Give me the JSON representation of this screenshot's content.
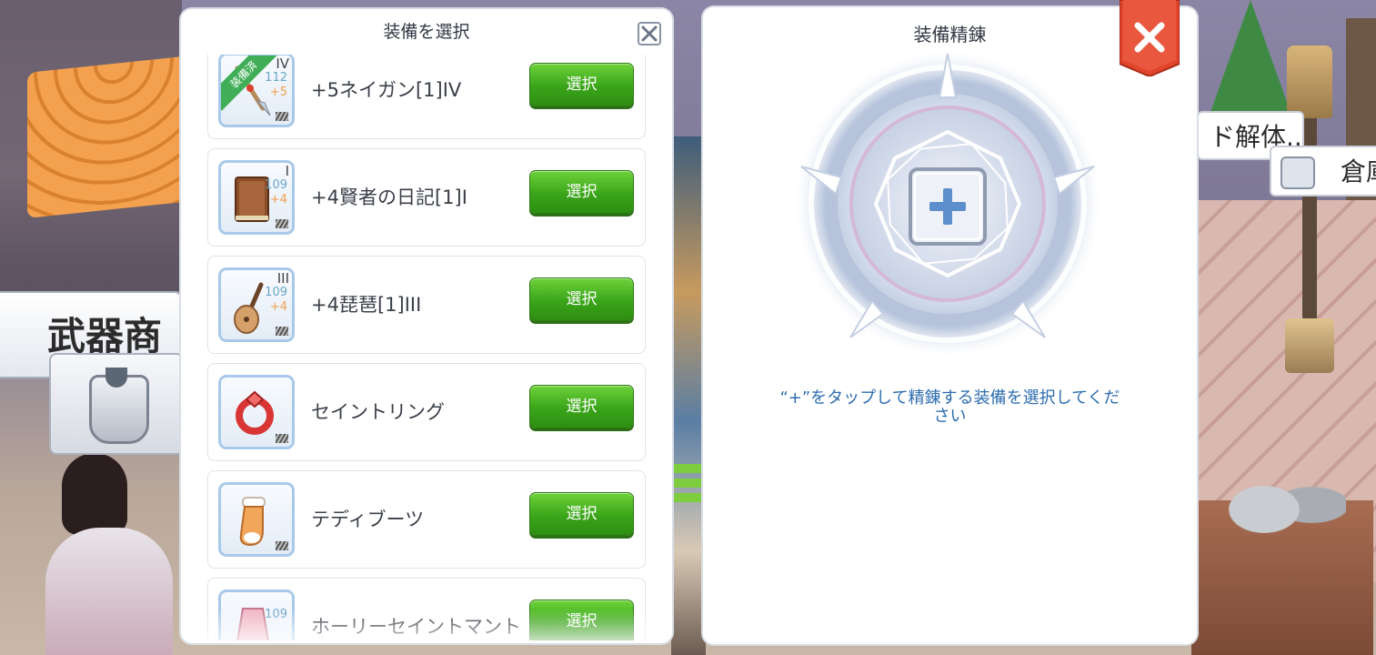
{
  "world": {
    "shop_sign": "武器商",
    "npc_label_1": "ド解体...",
    "npc_label_2": "倉庫"
  },
  "equip_select_panel": {
    "title": "装備を選択",
    "close_icon": "close-x-icon",
    "items": [
      {
        "name": "+5ネイガン[1]IV",
        "slot_badge": "IV",
        "attack": "112",
        "refine": "+5",
        "equipped_ribbon": "装備済",
        "select_label": "選択",
        "icon": "spear-icon"
      },
      {
        "name": "+4賢者の日記[1]I",
        "slot_badge": "I",
        "attack": "109",
        "refine": "+4",
        "select_label": "選択",
        "icon": "book-icon"
      },
      {
        "name": "+4琵琶[1]III",
        "slot_badge": "III",
        "attack": "109",
        "refine": "+4",
        "select_label": "選択",
        "icon": "lute-icon"
      },
      {
        "name": "セイントリング",
        "select_label": "選択",
        "icon": "ring-icon"
      },
      {
        "name": "テディブーツ",
        "select_label": "選択",
        "icon": "boots-icon"
      },
      {
        "name": "ホーリーセイントマント",
        "attack": "109",
        "select_label": "選択",
        "icon": "cape-icon"
      }
    ]
  },
  "refine_panel": {
    "title": "装備精錬",
    "add_slot_icon": "plus-icon",
    "hint_line1": "“+”をタップして精錬する装備を選択してくだ",
    "hint_line2": "さい",
    "close_icon": "close-red-x-icon"
  },
  "colors": {
    "select_button_green": "#3aa51a",
    "hint_blue": "#2d6db0",
    "close_red": "#e2452b",
    "refine_plus_blue": "#5e8fcd"
  }
}
